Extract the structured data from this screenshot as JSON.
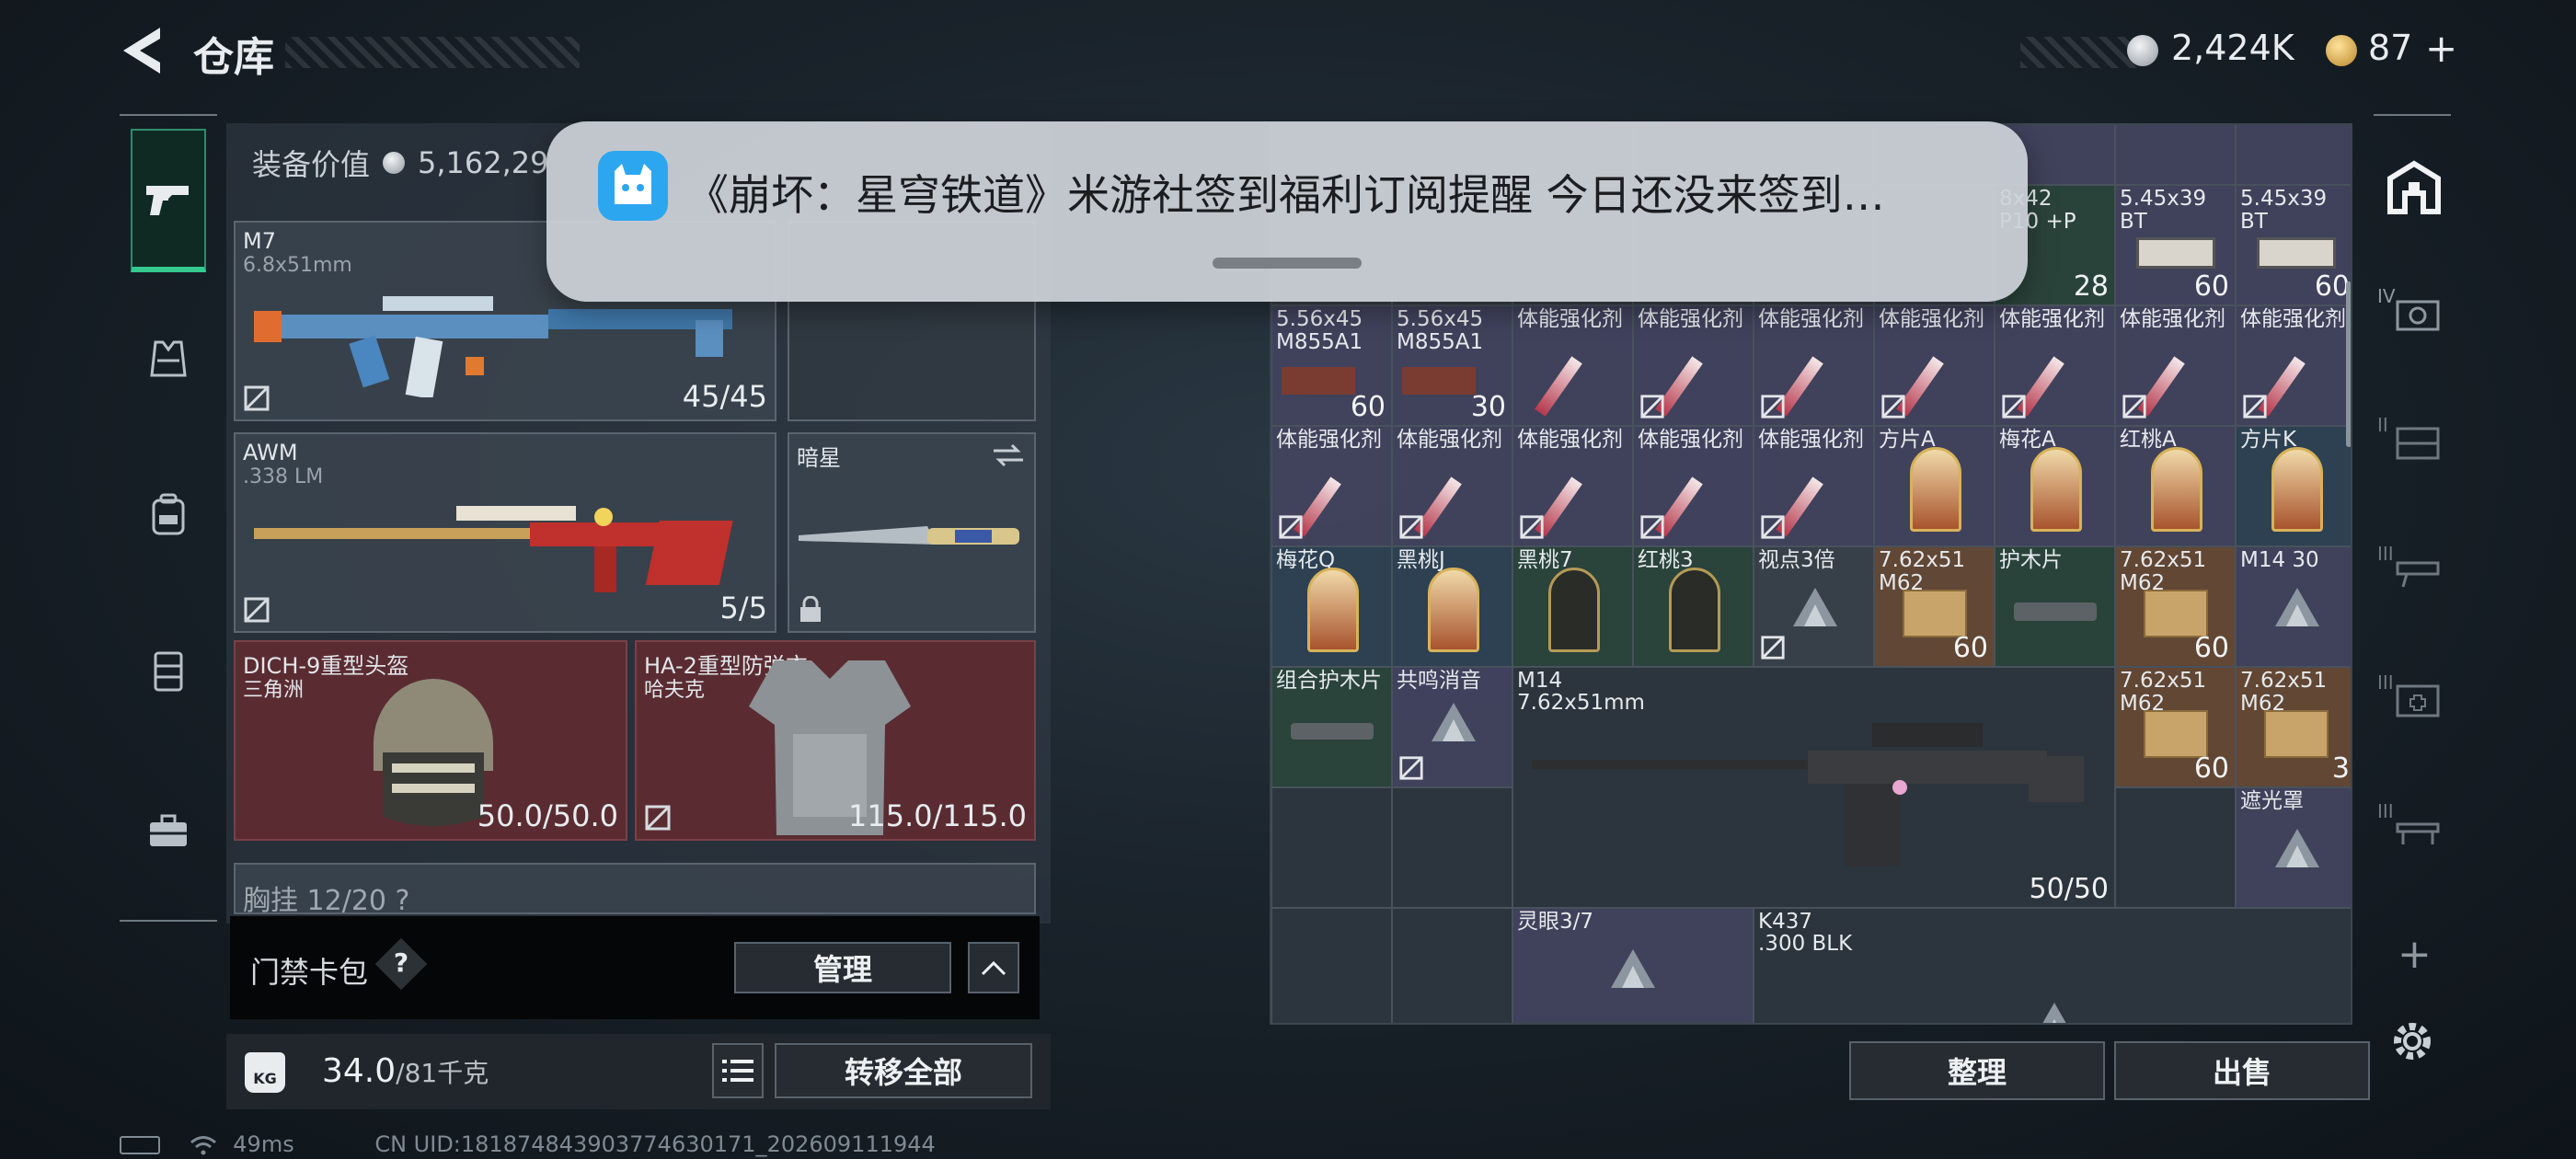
{
  "header": {
    "title": "仓库",
    "currency_silver": "2,424K",
    "currency_gold": "87",
    "add": "+"
  },
  "notification": {
    "message": "《崩坏：星穹铁道》米游社签到福利订阅提醒 今日还没来签到…"
  },
  "loadout": {
    "equip_value_label": "装备价值",
    "equip_value": "5,162,29",
    "primary": {
      "name": "M7",
      "caliber": "6.8x51mm",
      "ammo": "45/45"
    },
    "secondary": {
      "name": "AWM",
      "caliber": ".338 LM",
      "ammo": "5/5"
    },
    "melee": {
      "name": "暗星"
    },
    "helmet": {
      "name": "DICH-9重型头盔",
      "maker": "三角洲",
      "durability": "50.0/50.0"
    },
    "armor": {
      "name": "HA-2重型防弹衣",
      "maker": "哈夫克",
      "durability": "115.0/115.0"
    },
    "chest_rig_partial": "胸挂  12/20  ?",
    "card_bag_label": "门禁卡包",
    "card_bag_help": "?",
    "manage_label": "管理",
    "weight_value": "34.0",
    "weight_max": "/81千克",
    "weight_icon_label": "KG",
    "transfer_all_label": "转移全部"
  },
  "grid": {
    "row0": [
      {
        "label": "",
        "count": ""
      },
      {
        "label": "",
        "count": ""
      },
      {
        "label": "",
        "count": ""
      },
      {
        "label": "",
        "count": ""
      },
      {
        "label": "",
        "count": ""
      },
      {
        "label": "",
        "count": ""
      },
      {
        "label": "",
        "count": ""
      },
      {
        "label": "",
        "count": ""
      },
      {
        "label": "",
        "count": ""
      }
    ],
    "row1_partial": [
      {
        "label": "8x42\nP10 +P",
        "count": "28"
      },
      {
        "label": "5.45x39\nBT",
        "count": "60"
      },
      {
        "label": "5.45x39\nBT",
        "count": "60"
      }
    ],
    "row2": [
      {
        "label": "5.56x45\nM855A1",
        "count": "60"
      },
      {
        "label": "5.56x45\nM855A1",
        "count": "30"
      },
      {
        "label": "体能强化剂",
        "count": ""
      },
      {
        "label": "体能强化剂",
        "count": ""
      },
      {
        "label": "体能强化剂",
        "count": ""
      },
      {
        "label": "体能强化剂",
        "count": ""
      },
      {
        "label": "体能强化剂",
        "count": ""
      },
      {
        "label": "体能强化剂",
        "count": ""
      },
      {
        "label": "体能强化剂",
        "count": ""
      }
    ],
    "row3": [
      {
        "label": "体能强化剂",
        "count": ""
      },
      {
        "label": "体能强化剂",
        "count": ""
      },
      {
        "label": "体能强化剂",
        "count": ""
      },
      {
        "label": "体能强化剂",
        "count": ""
      },
      {
        "label": "体能强化剂",
        "count": ""
      },
      {
        "label": "方片A",
        "count": ""
      },
      {
        "label": "梅花A",
        "count": ""
      },
      {
        "label": "红桃A",
        "count": ""
      },
      {
        "label": "方片K",
        "count": ""
      }
    ],
    "row4": [
      {
        "label": "梅花Q",
        "count": ""
      },
      {
        "label": "黑桃J",
        "count": ""
      },
      {
        "label": "黑桃7",
        "count": ""
      },
      {
        "label": "红桃3",
        "count": ""
      },
      {
        "label": "视点3倍",
        "count": ""
      },
      {
        "label": "7.62x51\nM62",
        "count": "60"
      },
      {
        "label": "护木片",
        "count": ""
      },
      {
        "label": "7.62x51\nM62",
        "count": "60"
      },
      {
        "label": "M14 30",
        "count": ""
      }
    ],
    "row5": [
      {
        "label": "组合护木片",
        "count": ""
      },
      {
        "label": "共鸣消音",
        "count": ""
      },
      {
        "label": "7.62x51\nM62",
        "count": "60"
      },
      {
        "label": "7.62x51\nM62",
        "count": "3"
      }
    ],
    "m14": {
      "name": "M14",
      "caliber": "7.62x51mm",
      "ammo": "50/50"
    },
    "sunshade": {
      "label": "遮光罩"
    },
    "lingyan": {
      "label": "灵眼3/7"
    },
    "k437": {
      "name": "K437",
      "caliber": ".300 BLK"
    }
  },
  "actions": {
    "sort_label": "整理",
    "sell_label": "出售"
  },
  "right_rail": {
    "tab2": "IV",
    "tab3": "II",
    "tab4": "III",
    "tab5": "III",
    "tab6": "III",
    "add": "+"
  },
  "status": {
    "ping": "49ms",
    "uid": "CN UID:181874843903774630171_202609111944"
  },
  "colors": {
    "accent_green": "#35c98f",
    "slot_red": "#5a2c32",
    "notification_bg": "#cdd2d8"
  }
}
